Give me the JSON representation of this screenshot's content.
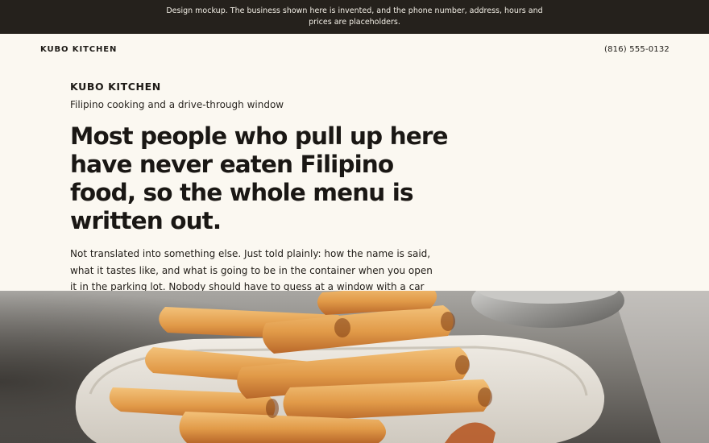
{
  "notice": {
    "text": "Design mockup. The business shown here is invented, and the phone number, address, hours and prices are placeholders."
  },
  "header": {
    "brand": "KUBO KITCHEN",
    "phone": "(816) 555-0132"
  },
  "hero": {
    "brand": "KUBO KITCHEN",
    "tagline": "Filipino cooking and a drive-through window",
    "headline": "Most people who pull up here have never eaten Filipino food, so the whole menu is written out.",
    "lede": "Not translated into something else. Just told plainly: how the name is said, what it tastes like, and what is going to be in the container when you open it in the parking lot. Nobody should have to guess at a window with a car behind them."
  },
  "colors": {
    "notice_bg": "#25211c",
    "page_bg": "#fbf8f1",
    "text": "#1d1a16"
  },
  "photo": {
    "icon": "fried-spring-rolls-on-plate-photo"
  }
}
